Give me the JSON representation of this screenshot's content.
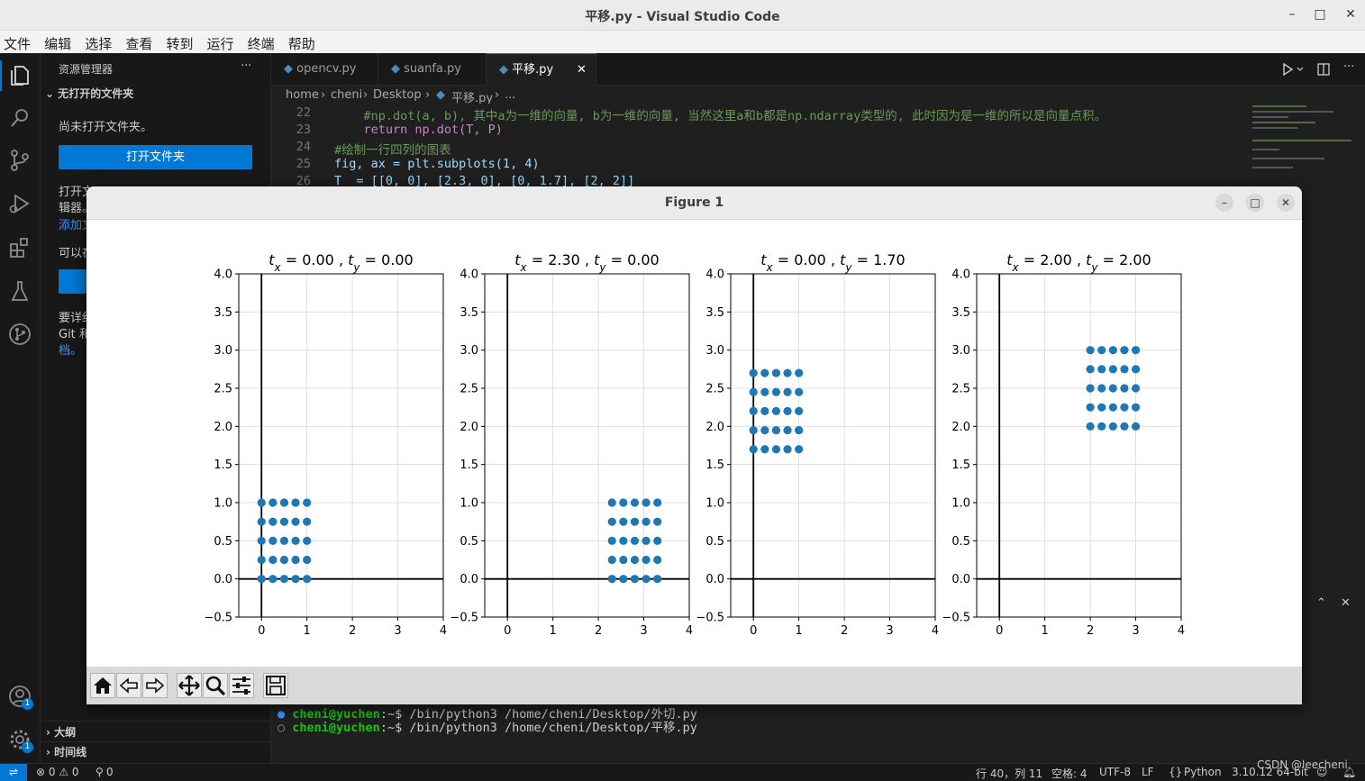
{
  "window": {
    "title": "平移.py - Visual Studio Code"
  },
  "menu": [
    "文件",
    "编辑",
    "选择",
    "查看",
    "转到",
    "运行",
    "终端",
    "帮助"
  ],
  "sidebar": {
    "header": "资源管理器",
    "more": "···",
    "section": "无打开的文件夹",
    "no_folder_text": "尚未打开文件夹。",
    "open_folder_button": "打开文件夹",
    "hint_1a": "打开文",
    "hint_1b": "辑器。",
    "hint_1c": "添加文",
    "hint_2": "可以在",
    "hint_3a": "要详细",
    "hint_3b": "Git 和",
    "hint_3c": "档。",
    "outline": "大纲",
    "timeline": "时间线"
  },
  "tabs": [
    {
      "label": "opencv.py"
    },
    {
      "label": "suanfa.py"
    },
    {
      "label": "平移.py",
      "close": "✕"
    }
  ],
  "breadcrumb": [
    "home",
    "cheni",
    "Desktop",
    "平移.py",
    "..."
  ],
  "code": [
    {
      "n": "22",
      "text": "    #np.dot(a, b), 其中a为一维的向量, b为一维的向量, 当然这里a和b都是np.ndarray类型的, 此时因为是一维的所以是向量点积。"
    },
    {
      "n": "23",
      "text": "    return np.dot(T, P)"
    },
    {
      "n": "24",
      "text": "#绘制一行四列的图表"
    },
    {
      "n": "25",
      "text": "fig, ax = plt.subplots(1, 4)"
    },
    {
      "n": "26",
      "text": "T  = [[0, 0], [2.3, 0], [0, 1.7], [2, 2]]"
    }
  ],
  "terminal": [
    {
      "user": "cheni@yuchen",
      "rest": ":~$ /bin/python3 /home/cheni/Desktop/外切.py"
    },
    {
      "user": "cheni@yuchen",
      "rest": ":~$ /bin/python3 /home/cheni/Desktop/平移.py"
    }
  ],
  "statusbar": {
    "errors": "⊗ 0 ⚠ 0",
    "ports": "0",
    "position": "行 40，列 11",
    "spaces": "空格: 4",
    "encoding": "UTF-8",
    "eol": "LF",
    "language": "Python",
    "interpreter": "3.10.12 64-bit",
    "watermark": "CSDN @leecheni"
  },
  "badges": {
    "accounts": "1",
    "settings": "1"
  },
  "figure": {
    "title": "Figure 1",
    "toolbar": [
      "home-icon",
      "back-icon",
      "forward-icon",
      "pan-icon",
      "zoom-icon",
      "configure-icon",
      "save-icon"
    ]
  },
  "chart_data": [
    {
      "type": "scatter",
      "title": "$t_x = 0.00$ , $t_y = 0.00$",
      "tx": "0.00",
      "ty": "0.00",
      "x": [
        0,
        0,
        0,
        0,
        0,
        0.25,
        0.25,
        0.25,
        0.25,
        0.25,
        0.5,
        0.5,
        0.5,
        0.5,
        0.5,
        0.75,
        0.75,
        0.75,
        0.75,
        0.75,
        1,
        1,
        1,
        1,
        1
      ],
      "y": [
        0,
        0.25,
        0.5,
        0.75,
        1,
        0,
        0.25,
        0.5,
        0.75,
        1,
        0,
        0.25,
        0.5,
        0.75,
        1,
        0,
        0.25,
        0.5,
        0.75,
        1,
        0,
        0.25,
        0.5,
        0.75,
        1
      ],
      "xlim": [
        -0.5,
        4
      ],
      "ylim": [
        -0.5,
        4
      ],
      "xticks": [
        "0",
        "1",
        "2",
        "3",
        "4"
      ],
      "yticks": [
        "−0.5",
        "0.0",
        "0.5",
        "1.0",
        "1.5",
        "2.0",
        "2.5",
        "3.0",
        "3.5",
        "4.0"
      ],
      "grid": true
    },
    {
      "type": "scatter",
      "title": "$t_x = 2.30$ , $t_y = 0.00$",
      "tx": "2.30",
      "ty": "0.00",
      "x": [
        2.3,
        2.3,
        2.3,
        2.3,
        2.3,
        2.55,
        2.55,
        2.55,
        2.55,
        2.55,
        2.8,
        2.8,
        2.8,
        2.8,
        2.8,
        3.05,
        3.05,
        3.05,
        3.05,
        3.05,
        3.3,
        3.3,
        3.3,
        3.3,
        3.3
      ],
      "y": [
        0,
        0.25,
        0.5,
        0.75,
        1,
        0,
        0.25,
        0.5,
        0.75,
        1,
        0,
        0.25,
        0.5,
        0.75,
        1,
        0,
        0.25,
        0.5,
        0.75,
        1,
        0,
        0.25,
        0.5,
        0.75,
        1
      ],
      "xlim": [
        -0.5,
        4
      ],
      "ylim": [
        -0.5,
        4
      ],
      "xticks": [
        "0",
        "1",
        "2",
        "3",
        "4"
      ],
      "yticks": [
        "−0.5",
        "0.0",
        "0.5",
        "1.0",
        "1.5",
        "2.0",
        "2.5",
        "3.0",
        "3.5",
        "4.0"
      ],
      "grid": true
    },
    {
      "type": "scatter",
      "title": "$t_x = 0.00$ , $t_y = 1.70$",
      "tx": "0.00",
      "ty": "1.70",
      "x": [
        0,
        0,
        0,
        0,
        0,
        0.25,
        0.25,
        0.25,
        0.25,
        0.25,
        0.5,
        0.5,
        0.5,
        0.5,
        0.5,
        0.75,
        0.75,
        0.75,
        0.75,
        0.75,
        1,
        1,
        1,
        1,
        1
      ],
      "y": [
        1.7,
        1.95,
        2.2,
        2.45,
        2.7,
        1.7,
        1.95,
        2.2,
        2.45,
        2.7,
        1.7,
        1.95,
        2.2,
        2.45,
        2.7,
        1.7,
        1.95,
        2.2,
        2.45,
        2.7,
        1.7,
        1.95,
        2.2,
        2.45,
        2.7
      ],
      "xlim": [
        -0.5,
        4
      ],
      "ylim": [
        -0.5,
        4
      ],
      "xticks": [
        "0",
        "1",
        "2",
        "3",
        "4"
      ],
      "yticks": [
        "−0.5",
        "0.0",
        "0.5",
        "1.0",
        "1.5",
        "2.0",
        "2.5",
        "3.0",
        "3.5",
        "4.0"
      ],
      "grid": true
    },
    {
      "type": "scatter",
      "title": "$t_x = 2.00$ , $t_y = 2.00$",
      "tx": "2.00",
      "ty": "2.00",
      "x": [
        2,
        2,
        2,
        2,
        2,
        2.25,
        2.25,
        2.25,
        2.25,
        2.25,
        2.5,
        2.5,
        2.5,
        2.5,
        2.5,
        2.75,
        2.75,
        2.75,
        2.75,
        2.75,
        3,
        3,
        3,
        3,
        3
      ],
      "y": [
        2,
        2.25,
        2.5,
        2.75,
        3,
        2,
        2.25,
        2.5,
        2.75,
        3,
        2,
        2.25,
        2.5,
        2.75,
        3,
        2,
        2.25,
        2.5,
        2.75,
        3,
        2,
        2.25,
        2.5,
        2.75,
        3
      ],
      "xlim": [
        -0.5,
        4
      ],
      "ylim": [
        -0.5,
        4
      ],
      "xticks": [
        "0",
        "1",
        "2",
        "3",
        "4"
      ],
      "yticks": [
        "−0.5",
        "0.0",
        "0.5",
        "1.0",
        "1.5",
        "2.0",
        "2.5",
        "3.0",
        "3.5",
        "4.0"
      ],
      "grid": true
    }
  ],
  "colors": {
    "point": "#1f77b4",
    "accent": "#0078d4",
    "terminal_user": "#16c60c"
  }
}
